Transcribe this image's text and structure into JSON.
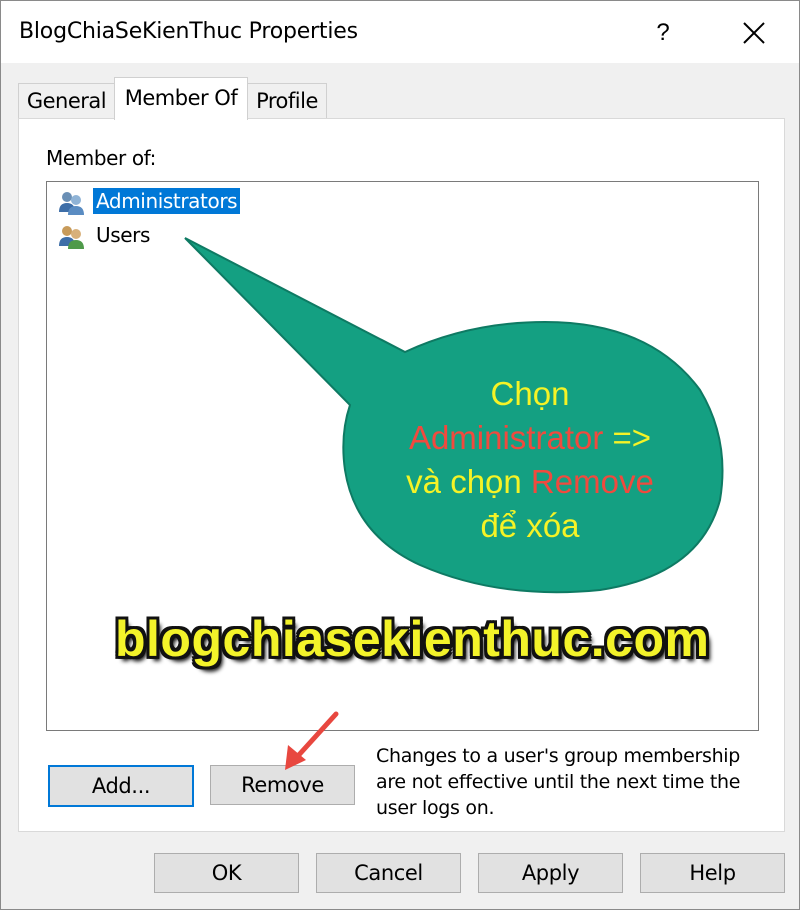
{
  "window": {
    "title": "BlogChiaSeKienThuc Properties",
    "help_glyph": "?"
  },
  "tabs": [
    {
      "label": "General"
    },
    {
      "label": "Member Of"
    },
    {
      "label": "Profile"
    }
  ],
  "member_of": {
    "label": "Member of:",
    "items": [
      {
        "label": "Administrators",
        "icon": "group-icon",
        "selected": true
      },
      {
        "label": "Users",
        "icon": "group-icon",
        "selected": false
      }
    ]
  },
  "buttons": {
    "add": "Add...",
    "remove": "Remove"
  },
  "note": "Changes to a user's group membership are not effective until the next time the user logs on.",
  "footer": {
    "ok": "OK",
    "cancel": "Cancel",
    "apply": "Apply",
    "help": "Help"
  },
  "annotation": {
    "line1": "Chọn",
    "line2_red": "Administrator",
    "line2_yellow": " =>",
    "line3_yellow": "và chọn ",
    "line3_red": "Remove",
    "line4": "để xóa",
    "bubble_color": "#14a082",
    "arrow_color": "#e8473f"
  },
  "watermark": "blogchiasekienthuc.com"
}
